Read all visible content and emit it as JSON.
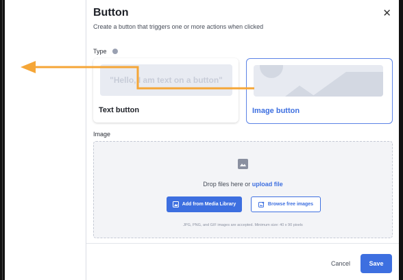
{
  "dialog": {
    "title": "Button",
    "subtitle": "Create a button that triggers one or more actions when clicked",
    "close_icon": "close-icon"
  },
  "type_section": {
    "label": "Type",
    "info_icon": "info-icon",
    "options": [
      {
        "label": "Text button",
        "preview_text": "\"Hello, I am text on a button\"",
        "selected": false
      },
      {
        "label": "Image button",
        "preview_icon": "image-placeholder",
        "selected": true
      }
    ]
  },
  "image_section": {
    "label": "Image",
    "drop_prefix": "Drop files here or ",
    "upload_link": "upload file",
    "media_button": "Add from Media Library",
    "free_button": "Browse free images",
    "hint": "JPG, PNG, and GIF images are accepted. Minimum size: 40 x 90 pixels"
  },
  "footer": {
    "cancel": "Cancel",
    "save": "Save"
  },
  "annotation": {
    "arrow_color": "#f5a637"
  },
  "colors": {
    "accent": "#3d6fe0",
    "selected_border": "#5a82e6"
  }
}
